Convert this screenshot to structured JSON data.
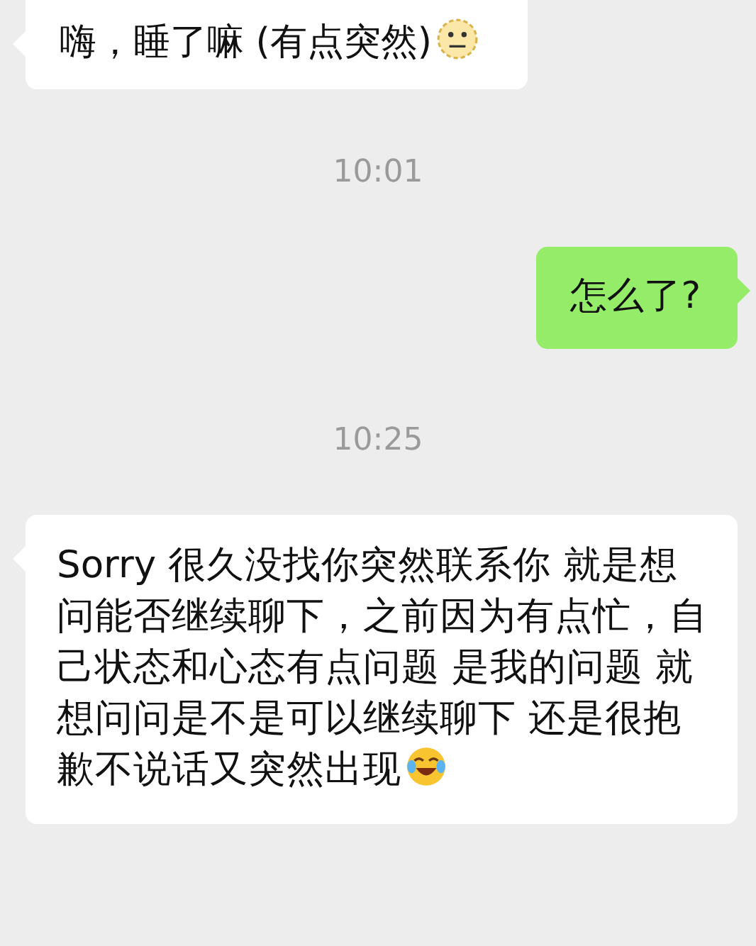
{
  "messages": [
    {
      "kind": "message",
      "outgoing": false,
      "parts": [
        {
          "kind": "text",
          "text": "嗨，睡了嘛 (有点突然)"
        },
        {
          "kind": "smiley"
        }
      ]
    },
    {
      "kind": "time",
      "text": "10:01"
    },
    {
      "kind": "message",
      "outgoing": true,
      "parts": [
        {
          "kind": "text",
          "text": "怎么了?"
        }
      ]
    },
    {
      "kind": "time",
      "text": "10:25"
    },
    {
      "kind": "message",
      "outgoing": false,
      "parts": [
        {
          "kind": "text",
          "text": "Sorry 很久没找你突然联系你 就是想问能否继续聊下，之前因为有点忙，自己状态和心态有点问题 是我的问题 就想问问是不是可以继续聊下 还是很抱歉不说话又突然出现"
        },
        {
          "kind": "laughing"
        }
      ]
    }
  ]
}
